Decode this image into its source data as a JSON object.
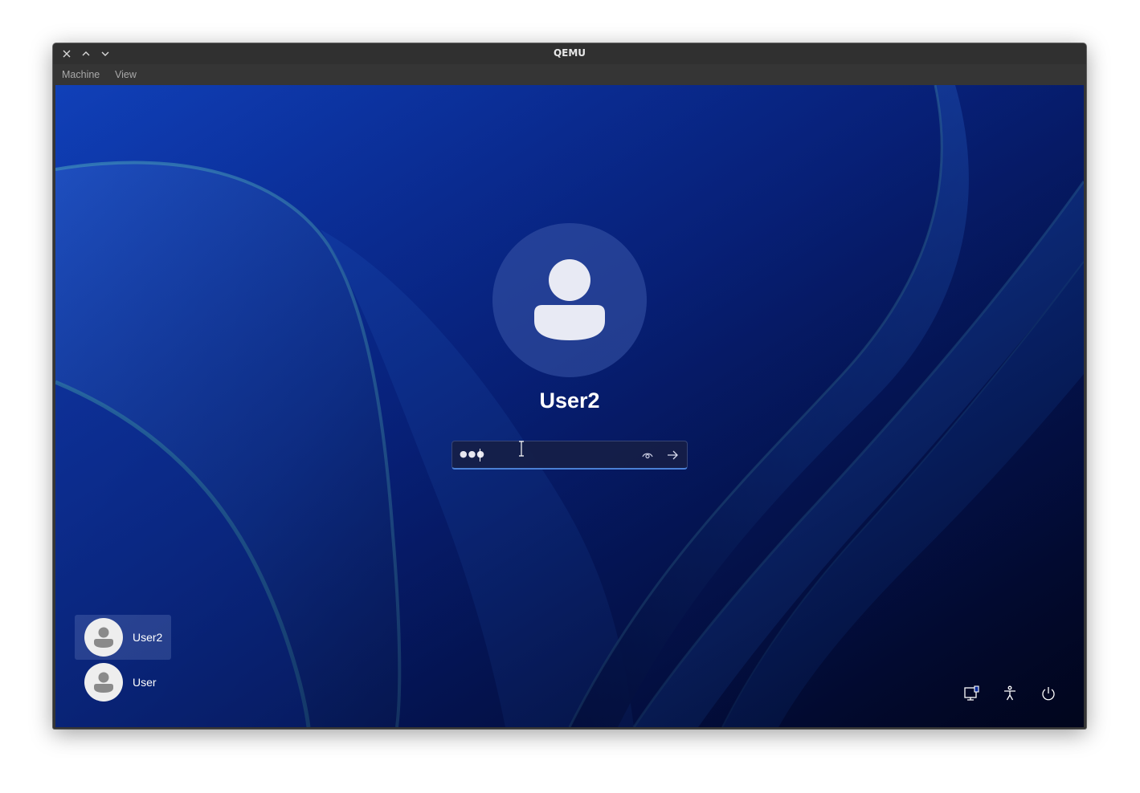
{
  "window": {
    "title": "QEMU",
    "controls": [
      "close-icon",
      "maximize-icon",
      "minimize-icon"
    ]
  },
  "menubar": {
    "items": [
      "Machine",
      "View"
    ]
  },
  "lockscreen": {
    "current_user": "User2",
    "password": {
      "masked_value": "●●●",
      "reveal_icon": "eye-icon",
      "submit_icon": "arrow-right-icon"
    },
    "users": [
      {
        "name": "User2",
        "selected": true
      },
      {
        "name": "User",
        "selected": false
      }
    ],
    "system_icons": [
      "network-icon",
      "accessibility-icon",
      "power-icon"
    ]
  },
  "colors": {
    "wallpaper_base": "#0a2a9a",
    "accent": "#4a7fd4",
    "titlebar": "#303030"
  }
}
